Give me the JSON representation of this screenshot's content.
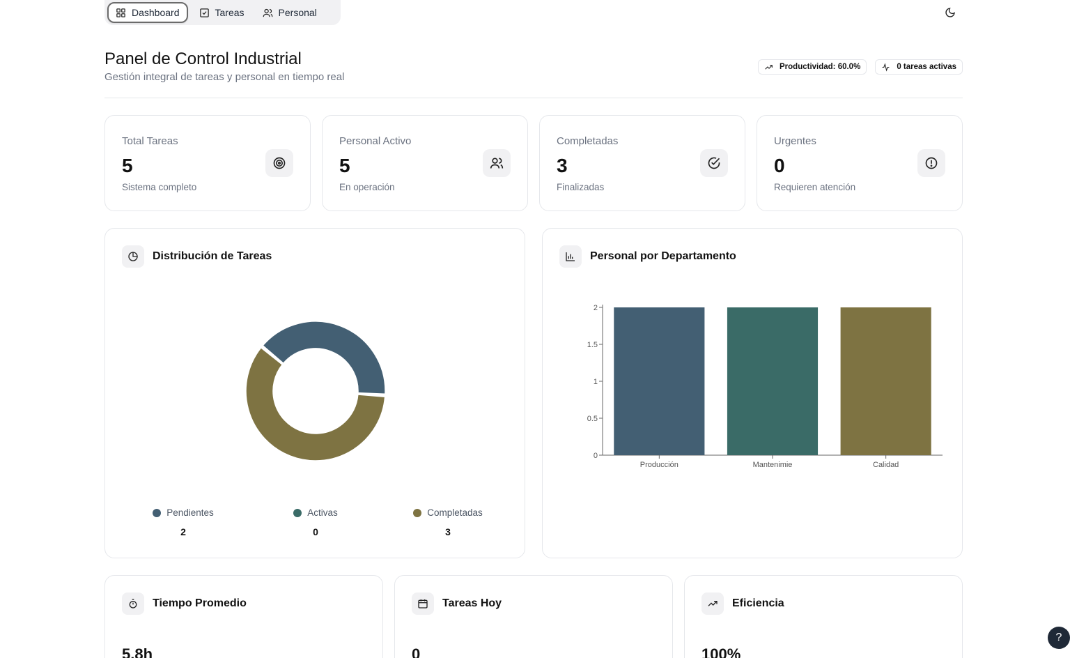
{
  "nav": {
    "items": [
      {
        "label": "Dashboard",
        "icon": "grid-icon",
        "active": true
      },
      {
        "label": "Tareas",
        "icon": "checkbox-icon",
        "active": false
      },
      {
        "label": "Personal",
        "icon": "users-icon",
        "active": false
      }
    ],
    "theme_icon": "moon-icon"
  },
  "header": {
    "title": "Panel de Control Industrial",
    "subtitle": "Gestión integral de tareas y personal en tiempo real",
    "badges": [
      {
        "label": "Productividad: 60.0%",
        "icon": "trending-up-icon"
      },
      {
        "label": "0 tareas activas",
        "icon": "activity-icon"
      }
    ]
  },
  "stats": [
    {
      "label": "Total Tareas",
      "value": "5",
      "note": "Sistema completo",
      "icon": "target-icon"
    },
    {
      "label": "Personal Activo",
      "value": "5",
      "note": "En operación",
      "icon": "users-icon"
    },
    {
      "label": "Completadas",
      "value": "3",
      "note": "Finalizadas",
      "icon": "check-circle-icon"
    },
    {
      "label": "Urgentes",
      "value": "0",
      "note": "Requieren atención",
      "icon": "alert-circle-icon"
    }
  ],
  "distribution": {
    "title": "Distribución de Tareas",
    "icon": "pie-chart-icon",
    "legend": [
      {
        "label": "Pendientes",
        "value": "2",
        "color": "#435f73"
      },
      {
        "label": "Activas",
        "value": "0",
        "color": "#3a6b67"
      },
      {
        "label": "Completadas",
        "value": "3",
        "color": "#7e7342"
      }
    ]
  },
  "department": {
    "title": "Personal por Departamento",
    "icon": "bar-chart-icon"
  },
  "chart_data": [
    {
      "type": "pie",
      "title": "Distribución de Tareas",
      "categories": [
        "Pendientes",
        "Activas",
        "Completadas"
      ],
      "values": [
        2,
        0,
        3
      ],
      "colors": [
        "#435f73",
        "#3a6b67",
        "#7e7342"
      ],
      "donut": true
    },
    {
      "type": "bar",
      "title": "Personal por Departamento",
      "categories": [
        "Producción",
        "Mantenimie",
        "Calidad"
      ],
      "values": [
        2,
        2,
        2
      ],
      "colors": [
        "#435f73",
        "#3a6b67",
        "#7e7342"
      ],
      "ylim": [
        0,
        2
      ],
      "yticks": [
        "0",
        "0.5",
        "1",
        "1.5",
        "2"
      ],
      "grid": false
    }
  ],
  "bottom_cards": [
    {
      "title": "Tiempo Promedio",
      "value": "5.8h",
      "icon": "timer-icon"
    },
    {
      "title": "Tareas Hoy",
      "value": "0",
      "icon": "calendar-icon"
    },
    {
      "title": "Eficiencia",
      "value": "100%",
      "icon": "trending-up-icon"
    }
  ],
  "help": {
    "label": "?"
  }
}
